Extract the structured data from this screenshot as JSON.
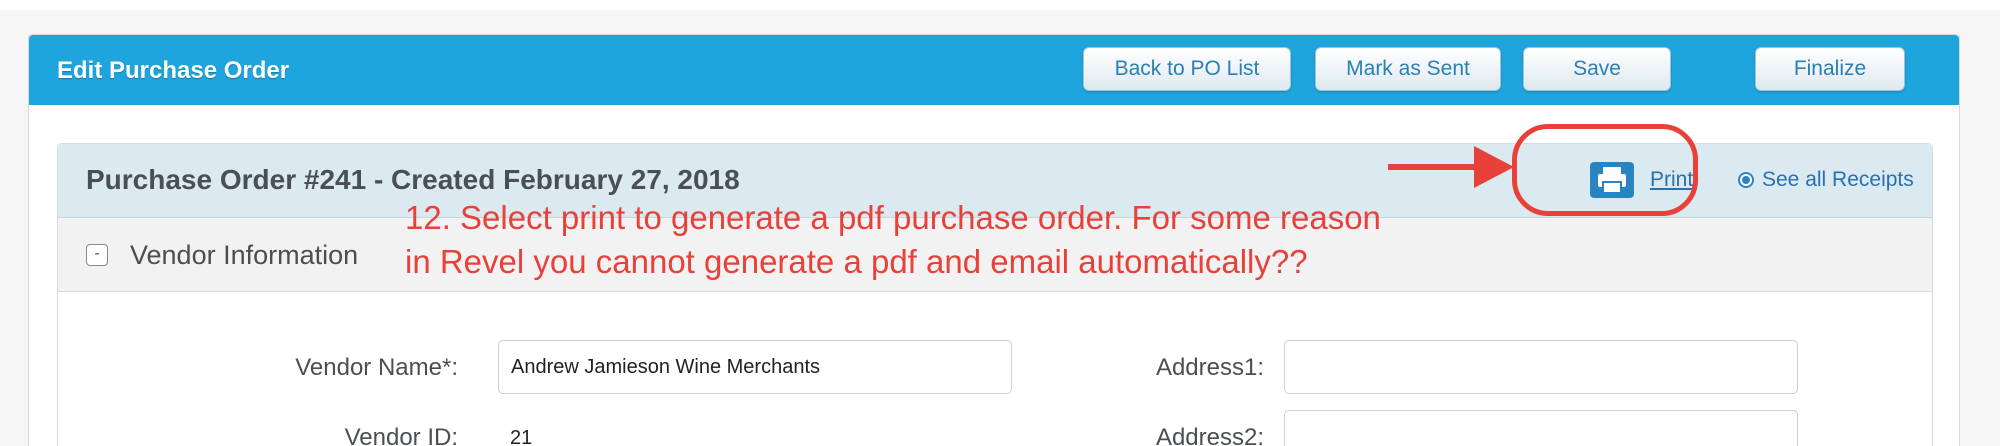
{
  "header": {
    "title": "Edit Purchase Order",
    "buttons": {
      "back": "Back to PO List",
      "mark_sent": "Mark as Sent",
      "save": "Save",
      "finalize": "Finalize"
    },
    "bar_color": "#1ea5dd"
  },
  "purchase_order": {
    "title": "Purchase Order #241 - Created February 27, 2018",
    "print_label": "Print",
    "receipts_label": "See all Receipts"
  },
  "vendor": {
    "section_label": "Vendor Information",
    "collapse_symbol": "-",
    "fields": {
      "name_label": "Vendor Name*:",
      "name_value": "Andrew Jamieson Wine Merchants",
      "id_label": "Vendor ID:",
      "id_value": "21",
      "address1_label": "Address1:",
      "address1_value": "",
      "address2_label": "Address2:",
      "address2_value": ""
    }
  },
  "annotation": {
    "line1": "12. Select print to generate a pdf purchase order. For some reason",
    "line2": "in Revel you cannot generate a pdf and email automatically??",
    "color": "#e8413a"
  },
  "icons": {
    "print": "printer-icon",
    "radio": "radio-selected-icon",
    "arrow": "arrow-right-icon"
  }
}
